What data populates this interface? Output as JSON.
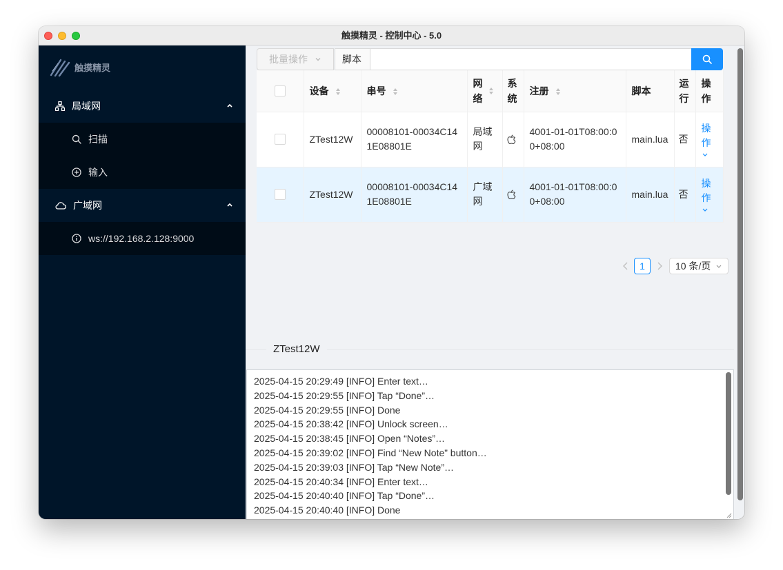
{
  "window": {
    "title": "触摸精灵 - 控制中心 - 5.0"
  },
  "sidebar": {
    "logo_text": "触摸精灵",
    "groups": [
      {
        "label": "局域网",
        "icon": "network-icon",
        "items": [
          {
            "label": "扫描",
            "icon": "search-icon"
          },
          {
            "label": "输入",
            "icon": "plus-circle-icon"
          }
        ]
      },
      {
        "label": "广域网",
        "icon": "cloud-icon",
        "items": [
          {
            "label": "ws://192.168.2.128:9000",
            "icon": "info-circle-icon"
          }
        ]
      }
    ]
  },
  "toolbar": {
    "batch_label": "批量操作",
    "select_value": "脚本",
    "search_value": "",
    "search_placeholder": ""
  },
  "table": {
    "columns": [
      "设备",
      "串号",
      "网络",
      "系统",
      "注册",
      "脚本",
      "运行",
      "操作"
    ],
    "rows": [
      {
        "device": "ZTest12W",
        "serial": "00008101-00034C141E08801E",
        "network": "局域网",
        "system": "apple-icon",
        "registered": "4001-01-01T08:00:00+08:00",
        "script": "main.lua",
        "running": "否",
        "action": "操作"
      },
      {
        "device": "ZTest12W",
        "serial": "00008101-00034C141E08801E",
        "network": "广域网",
        "system": "apple-icon",
        "registered": "4001-01-01T08:00:00+08:00",
        "script": "main.lua",
        "running": "否",
        "action": "操作"
      }
    ]
  },
  "pagination": {
    "current": "1",
    "page_size": "10 条/页"
  },
  "log": {
    "tab": "ZTest12W",
    "lines": [
      "2025-04-15 20:29:49 [INFO] Enter text…",
      "2025-04-15 20:29:55 [INFO] Tap “Done”…",
      "2025-04-15 20:29:55 [INFO] Done",
      "2025-04-15 20:38:42 [INFO] Unlock screen…",
      "2025-04-15 20:38:45 [INFO] Open “Notes”…",
      "2025-04-15 20:39:02 [INFO] Find “New Note” button…",
      "2025-04-15 20:39:03 [INFO] Tap “New Note”…",
      "2025-04-15 20:40:34 [INFO] Enter text…",
      "2025-04-15 20:40:40 [INFO] Tap “Done”…",
      "2025-04-15 20:40:40 [INFO] Done"
    ]
  },
  "colors": {
    "sidebar_bg": "#001529",
    "submenu_bg": "#000c17",
    "accent": "#1890ff",
    "row_hover": "#e6f4ff"
  }
}
